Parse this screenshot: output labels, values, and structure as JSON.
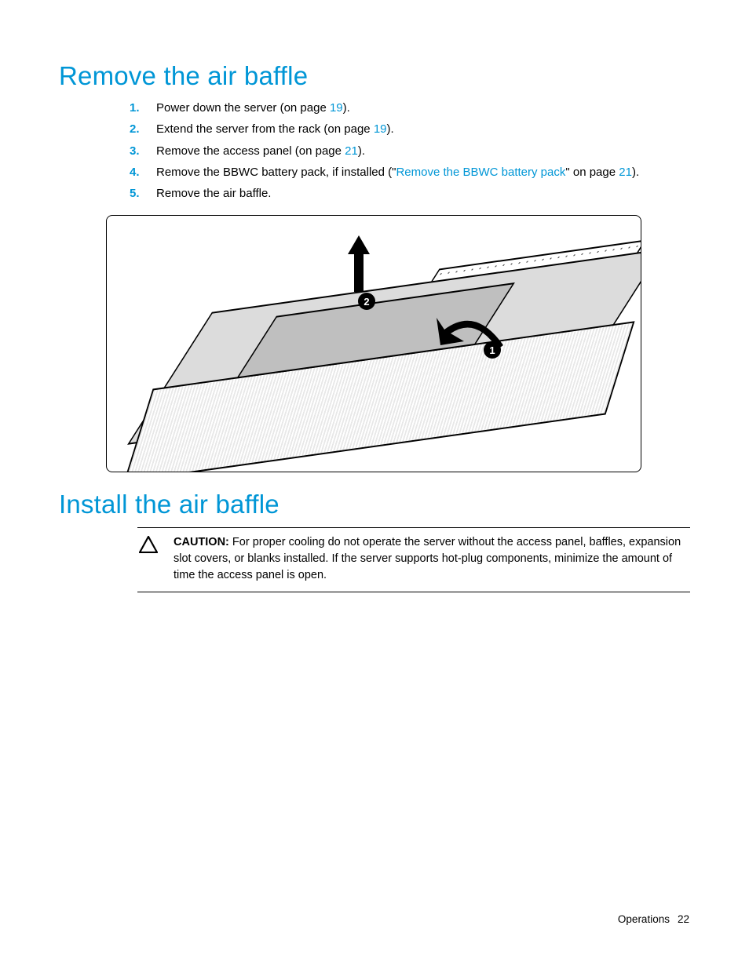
{
  "section1": {
    "title": "Remove the air baffle",
    "steps": [
      {
        "pre": "Power down the server (on page ",
        "link": "19",
        "post": ")."
      },
      {
        "pre": "Extend the server from the rack (on page ",
        "link": "19",
        "post": ")."
      },
      {
        "pre": "Remove the access panel (on page ",
        "link": "21",
        "post": ")."
      },
      {
        "pre": "Remove the BBWC battery pack, if installed (\"",
        "link": "Remove the BBWC battery pack",
        "mid": "\" on page ",
        "link2": "21",
        "post": ")."
      },
      {
        "pre": "Remove the air baffle.",
        "link": "",
        "post": ""
      }
    ],
    "callouts": {
      "c1": "1",
      "c2": "2"
    }
  },
  "section2": {
    "title": "Install the air baffle",
    "caution_label": "CAUTION:",
    "caution_text": " For proper cooling do not operate the server without the access panel, baffles, expansion slot covers, or blanks installed. If the server supports hot-plug components, minimize the amount of time the access panel is open."
  },
  "footer": {
    "chapter": "Operations",
    "page": "22"
  }
}
